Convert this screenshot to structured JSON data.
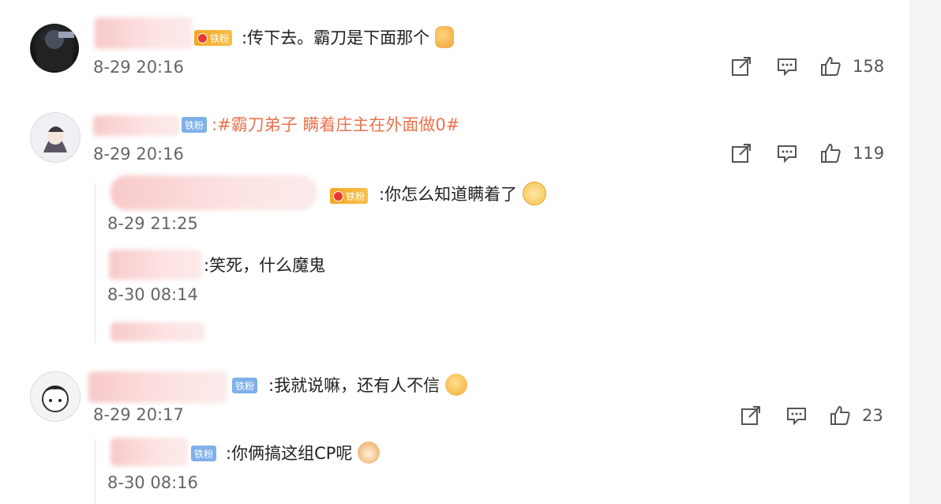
{
  "comments": [
    {
      "text_before": ":传下去。霸刀是下面那个",
      "emoji": "thumbs-up",
      "time": "8-29 20:16",
      "likes": "158"
    },
    {
      "text_topic": ":#霸刀弟子 瞒着庄主在外面做0#",
      "time": "8-29 20:16",
      "likes": "119",
      "replies": [
        {
          "text": ":你怎么知道瞒着了",
          "emoji": "cat-heart",
          "time": "8-29 21:25"
        },
        {
          "text": ":笑死，什么魔鬼",
          "time": "8-30 08:14"
        }
      ]
    },
    {
      "text": ":我就说嘛，还有人不信",
      "emoji": "smile",
      "time": "8-29 20:17",
      "likes": "23",
      "replies": [
        {
          "text": ":你俩搞这组CP呢",
          "emoji": "cat",
          "time": "8-30 08:16"
        }
      ]
    }
  ],
  "badges": {
    "gold": "铁粉",
    "blue": "铁粉"
  },
  "icons": [
    "share-icon",
    "comment-icon",
    "like-icon"
  ],
  "colors": {
    "topic": "#eb7350",
    "time": "#666666",
    "badge_gold": "#f5a623",
    "badge_blue": "#7fb0ea"
  }
}
